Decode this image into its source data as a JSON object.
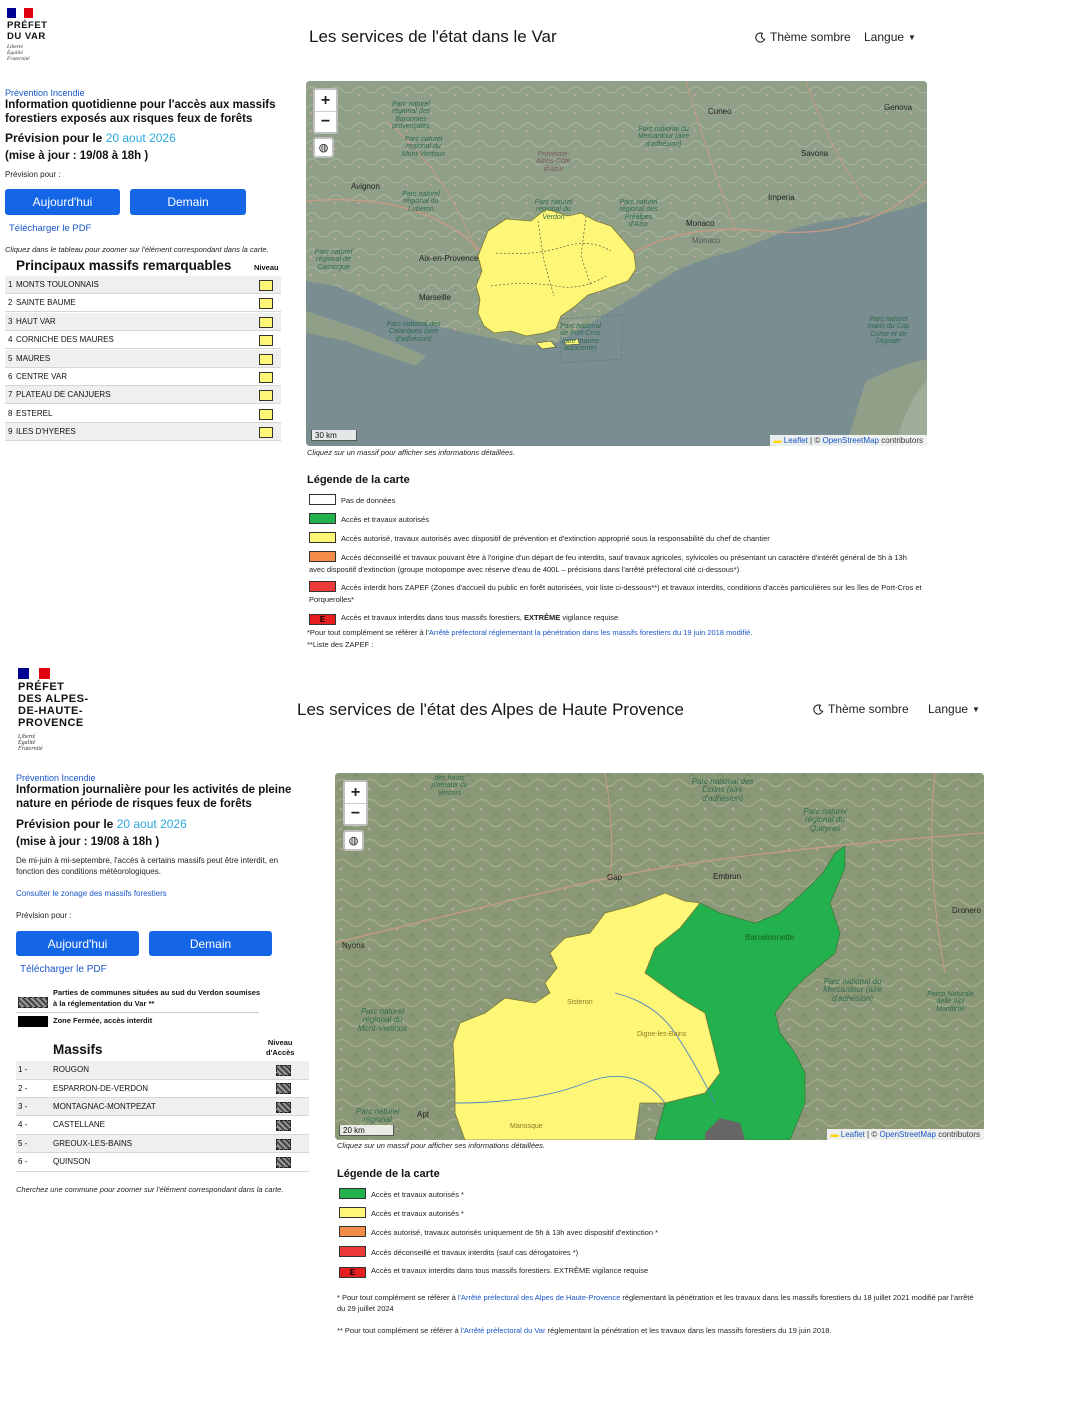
{
  "section1": {
    "logo": {
      "title": "PRÉFET\nDU VAR",
      "motto": "Liberté\nÉgalité\nFraternité"
    },
    "header": {
      "title": "Les services de l'état dans le Var",
      "theme": "Thème sombre",
      "lang": "Langue"
    },
    "category": "Prévention Incendie",
    "info_title": "Information quotidienne pour l'accès aux massifs forestiers exposés aux risques feux de forêts",
    "forecast_label": "Prévision pour le",
    "forecast_date": "20 aout 2026",
    "update": "(mise à jour : 19/08 à 18h )",
    "forecast_for": "Prévision pour :",
    "btn_today": "Aujourd'hui",
    "btn_tomorrow": "Demain",
    "pdf": "Télécharger le PDF",
    "table_hint": "Cliquez dans le tableau pour zoomer sur l'élément correspondant dans la carte.",
    "table_title": "Principaux massifs remarquables",
    "table_level": "Niveau",
    "massifs": [
      {
        "num": "1",
        "name": "MONTS TOULONNAIS"
      },
      {
        "num": "2",
        "name": "SAINTE BAUME"
      },
      {
        "num": "3",
        "name": "HAUT VAR"
      },
      {
        "num": "4",
        "name": "CORNICHE DES MAURES"
      },
      {
        "num": "5",
        "name": "MAURES"
      },
      {
        "num": "6",
        "name": "CENTRE VAR"
      },
      {
        "num": "7",
        "name": "PLATEAU DE CANJUERS"
      },
      {
        "num": "8",
        "name": "ESTEREL"
      },
      {
        "num": "9",
        "name": "ILES D'HYERES"
      }
    ],
    "map": {
      "scale": "30 km",
      "attr_leaflet": "Leaflet",
      "attr_osm": "OpenStreetMap",
      "attr_contrib": "contributors",
      "attr_sep": "| ©",
      "hint": "Cliquez sur un massif pour afficher ses informations détaillées.",
      "labels": {
        "baronnies": "Parc naturel régional des Baronnies provençales",
        "ventoux": "Parc naturel régional du Mont-Ventoux",
        "luberon": "Parc naturel régional du Luberon",
        "camargue": "Parc naturel régional de Camargue",
        "calanques": "Parc national des Calanques (aire d'adhésion)",
        "verdon": "Parc naturel régional du Verdon",
        "mercantour": "Parc national du Mercantour (aire d'adhésion)",
        "prealpes": "Parc naturel régional des Préalpes d'Azur",
        "cap_corse": "Parc naturel marin du Cap Corse et de l'Agriate",
        "portcros": "Parc national de Port-Cros (aire marine adjacente)",
        "paca": "Provence-Alpes-Côte d'Azur"
      },
      "cities": {
        "genova": "Genova",
        "cuneo": "Cuneo",
        "savona": "Savona",
        "imperia": "Imperia",
        "monaco": "Monaco",
        "monaco2": "Monaco",
        "avignon": "Avignon",
        "aix": "Aix-en-Provence",
        "marseille": "Marseille"
      }
    },
    "legend": {
      "title": "Légende de la carte",
      "items": [
        {
          "color": "#ffffff",
          "text": "Pas de données",
          "mark": ""
        },
        {
          "color": "#22b14c",
          "text": "Accès et travaux autorisés",
          "mark": ""
        },
        {
          "color": "#fdf676",
          "text": "Accès autorisé, travaux autorisés avec dispositif de prévention et d'extinction approprié sous la responsabilité du chef de chantier",
          "mark": ""
        },
        {
          "color": "#f28c47",
          "text": "Accès déconseillé et travaux pouvant être à l'origine d'un départ de feu interdits, sauf travaux agricoles, sylvicoles ou présentant un caractère d'intérêt général de 5h à 13h avec dispositif d'extinction (groupe motopompe avec réserve d'eau de 400L – précisions dans l'arrêté préfectoral cité ci-dessous*)",
          "mark": ""
        },
        {
          "color": "#ec3a3a",
          "text": "Accès interdit hors ZAPEF (Zones d'accueil du public en forêt autorisées, voir liste ci-dessous**) et travaux interdits, conditions d'accès particulières sur les îles de Port-Cros et Porquerolles*",
          "mark": ""
        },
        {
          "color": "#e51f1f",
          "text_a": "Accès et travaux interdits dans tous massifs forestiers, ",
          "text_b": "EXTRÊME",
          "text_c": " vigilance requise",
          "mark": "E"
        }
      ],
      "note1_a": "*Pour tout complément se référer à l'",
      "note1_link": "Arrêté préfectoral réglementant la pénétration dans les massifs forestiers du 19 juin 2018 modifié.",
      "note2": "**Liste des ZAPEF :"
    }
  },
  "section2": {
    "logo": {
      "title": "PRÉFET\nDES ALPES-\nDE-HAUTE-\nPROVENCE",
      "motto": "Liberté\nÉgalité\nFraternité"
    },
    "header": {
      "title": "Les services de l'état des Alpes de Haute Provence",
      "theme": "Thème sombre",
      "lang": "Langue"
    },
    "category": "Prévention Incendie",
    "info_title": "Information journalière pour les activités de pleine nature en période de risques feux de forêts",
    "forecast_label": "Prévision pour le",
    "forecast_date": "20 aout 2026",
    "update": "(mise à jour : 19/08 à 18h )",
    "intro": "De mi-juin à mi-septembre, l'accès à certains massifs peut être interdit, en fonction des conditions météorologiques.",
    "zonage_link": "Consulter le zonage des massifs forestiers",
    "forecast_for": "Prévision pour :",
    "btn_today": "Aujourd'hui",
    "btn_tomorrow": "Demain",
    "pdf": "Télécharger le PDF",
    "key1": "Parties de communes situées au sud du Verdon soumises à la réglementation du Var **",
    "key2": "Zone Fermée, accès interdit",
    "table_title": "Massifs",
    "table_level": "Niveau\nd'Accès",
    "massifs": [
      {
        "num": "1 -",
        "name": "ROUGON"
      },
      {
        "num": "2 -",
        "name": "ESPARRON-DE-VERDON"
      },
      {
        "num": "3 -",
        "name": "MONTAGNAC-MONTPEZAT"
      },
      {
        "num": "4 -",
        "name": "CASTELLANE"
      },
      {
        "num": "5 -",
        "name": "GREOUX-LES-BAINS"
      },
      {
        "num": "6 -",
        "name": "QUINSON"
      }
    ],
    "search_hint": "Cherchez une commune pour zoomer sur l'élément correspondant dans la carte.",
    "map": {
      "scale": "20 km",
      "attr_leaflet": "Leaflet",
      "attr_osm": "OpenStreetMap",
      "attr_contrib": "contributors",
      "attr_sep": "| ©",
      "hint": "Cliquez sur un massif pour afficher ses informations détaillées.",
      "labels": {
        "ecrins": "Parc national des Écrins (aire d'adhésion)",
        "queyras": "Parc naturel régional du Queyras",
        "mercantour": "Parc national du Mercantour (aire d'adhésion)",
        "alpi": "Parco Naturale delle Alpi Marittime",
        "ventoux": "Parc naturel régional du Mont-Ventoux",
        "luberon": "Parc naturel régional",
        "baronnies": "des hauts plateaux du Vercors"
      },
      "cities": {
        "gap": "Gap",
        "embrun": "Embrun",
        "barcelonnette": "Barcelonnette",
        "dronero": "Dronero",
        "digne": "Digne-les-Bains",
        "nyons": "Nyons",
        "apt": "Apt",
        "manosque": "Manosque",
        "sisteron": "Sisteron"
      }
    },
    "legend": {
      "title": "Légende de la carte",
      "items": [
        {
          "color": "#22b14c",
          "text": "Accès et travaux autorisés *",
          "mark": ""
        },
        {
          "color": "#fdf676",
          "text": "Accès et travaux autorisés *",
          "mark": ""
        },
        {
          "color": "#f28c47",
          "text": "Accès autorisé, travaux autorisés uniquement de 5h à 13h avec dispositif d'extinction *",
          "mark": ""
        },
        {
          "color": "#ec3a3a",
          "text": "Accès déconseillé et travaux interdits (sauf cas dérogatoires *)",
          "mark": ""
        },
        {
          "color": "#e51f1f",
          "text": "Accès et travaux interdits dans tous massifs forestiers. EXTRÊME vigilance requise",
          "mark": "E"
        }
      ],
      "note1_a": "* Pour tout complément se référer à ",
      "note1_link": "l'Arrêté préfectoral des Alpes de Haute-Provence",
      "note1_b": " réglementant la pénétration et les travaux dans les massifs forestiers du 18 juillet 2021 modifié par l'arrêté du 29 juillet 2024",
      "note2_a": "** Pour tout complément se référer à ",
      "note2_link": "l'Arrêté préfectoral du Var",
      "note2_b": " réglementant la pénétration et les travaux dans les massifs forestiers du 19 juin 2018."
    }
  }
}
